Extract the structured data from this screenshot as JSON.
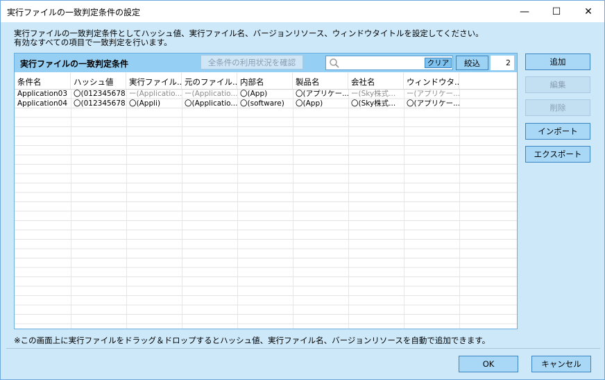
{
  "window": {
    "title": "実行ファイルの一致判定条件の設定",
    "controls": {
      "minimize": "—",
      "maximize": "☐",
      "close": "✕"
    }
  },
  "description": {
    "line1": "実行ファイルの一致判定条件としてハッシュ値、実行ファイル名、バージョンリソース、ウィンドウタイトルを設定してください。",
    "line2": "有効なすべての項目で一致判定を行います。"
  },
  "panel": {
    "title": "実行ファイルの一致判定条件",
    "check_all_label": "全条件の利用状況を確認",
    "search_placeholder": "",
    "search_value": "",
    "clear_label": "クリア",
    "filter_label": "絞込",
    "count": "2"
  },
  "table": {
    "headers": [
      "条件名",
      "ハッシュ値",
      "実行ファイル...",
      "元のファイル...",
      "内部名",
      "製品名",
      "会社名",
      "ウィンドウタ..."
    ],
    "rows": [
      [
        "Application03",
        "〇(012345678...",
        "ー(Applicatio...",
        "ー(Applicatio...",
        "〇(App)",
        "〇(アプリケー...",
        "ー(Sky株式...",
        "ー(アプリケー..."
      ],
      [
        "Application04",
        "〇(012345678...",
        "〇(Appli)",
        "〇(Applicatio...",
        "〇(software)",
        "〇(App)",
        "〇(Sky株式...",
        "〇(アプリケー..."
      ]
    ],
    "dim_cells": [
      [
        0,
        2
      ],
      [
        0,
        3
      ],
      [
        0,
        6
      ],
      [
        0,
        7
      ]
    ]
  },
  "side_buttons": {
    "add": "追加",
    "edit": "編集",
    "delete": "削除",
    "import": "インポート",
    "export": "エクスポート"
  },
  "note": "※この画面上に実行ファイルをドラッグ＆ドロップするとハッシュ値、実行ファイル名、バージョンリソースを自動で追加できます。",
  "footer": {
    "ok": "OK",
    "cancel": "キャンセル"
  },
  "colors": {
    "background": "#cde8f9",
    "panel_header": "#95d0f4",
    "button": "#a8d8f6",
    "border_accent": "#3a84c2"
  }
}
